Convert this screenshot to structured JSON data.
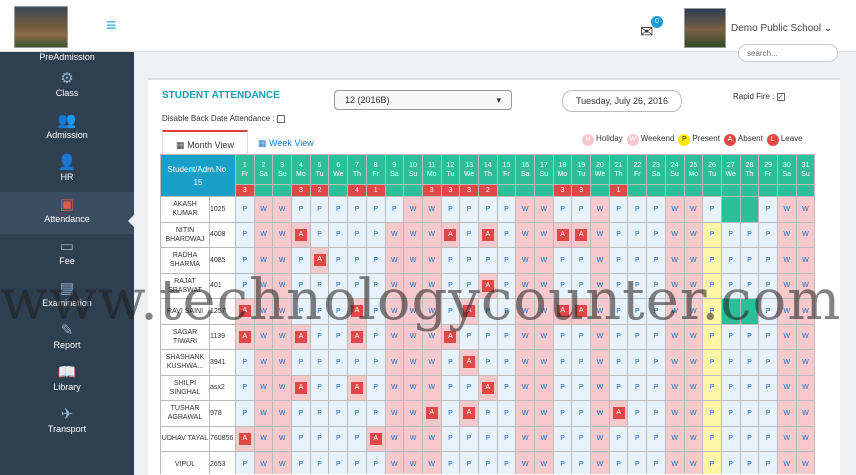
{
  "topbar": {
    "notification_count": "0",
    "school_name": "Demo Public School ⌄"
  },
  "sidebar": {
    "top_label": "PreAdmission",
    "items": [
      {
        "label": "Class",
        "icon": "gear-icon",
        "glyph": "⚙"
      },
      {
        "label": "Admission",
        "icon": "users-icon",
        "glyph": "👥"
      },
      {
        "label": "HR",
        "icon": "person-icon",
        "glyph": "👤"
      },
      {
        "label": "Attendance",
        "icon": "attendance-icon",
        "glyph": "▣"
      },
      {
        "label": "Fee",
        "icon": "card-icon",
        "glyph": "▭"
      },
      {
        "label": "Examination",
        "icon": "exam-icon",
        "glyph": "▤"
      },
      {
        "label": "Report",
        "icon": "edit-icon",
        "glyph": "✎"
      },
      {
        "label": "Library",
        "icon": "book-icon",
        "glyph": "📖"
      },
      {
        "label": "Transport",
        "icon": "plane-icon",
        "glyph": "✈"
      }
    ]
  },
  "search": {
    "placeholder": "search..."
  },
  "attendance": {
    "title": "STUDENT ATTENDANCE",
    "class_selected": "12 (2016B)",
    "date": "Tuesday, July 26, 2016",
    "rapid_fire_label": "Rapid Fire :",
    "disable_back_label": "Disable Back Date Attendance :",
    "tab_month": "Month View",
    "tab_week": "Week View",
    "legend": [
      {
        "key": "H",
        "label": "Holiday"
      },
      {
        "key": "W",
        "label": "Weekend"
      },
      {
        "key": "P",
        "label": "Present"
      },
      {
        "key": "A",
        "label": "Absent"
      },
      {
        "key": "L",
        "label": "Leave"
      }
    ],
    "header_student": "Student/Adm.No.",
    "header_count": "15",
    "days": [
      [
        "1",
        "Fr"
      ],
      [
        "2",
        "Sa"
      ],
      [
        "3",
        "Su"
      ],
      [
        "4",
        "Mo"
      ],
      [
        "5",
        "Tu"
      ],
      [
        "6",
        "We"
      ],
      [
        "7",
        "Th"
      ],
      [
        "8",
        "Fr"
      ],
      [
        "9",
        "Sa"
      ],
      [
        "10",
        "Su"
      ],
      [
        "11",
        "Mo"
      ],
      [
        "12",
        "Tu"
      ],
      [
        "13",
        "We"
      ],
      [
        "14",
        "Th"
      ],
      [
        "15",
        "Fr"
      ],
      [
        "16",
        "Sa"
      ],
      [
        "17",
        "Su"
      ],
      [
        "18",
        "Mo"
      ],
      [
        "19",
        "Tu"
      ],
      [
        "20",
        "We"
      ],
      [
        "21",
        "Th"
      ],
      [
        "22",
        "Fr"
      ],
      [
        "23",
        "Sa"
      ],
      [
        "24",
        "Su"
      ],
      [
        "25",
        "Mo"
      ],
      [
        "26",
        "Tu"
      ],
      [
        "27",
        "We"
      ],
      [
        "28",
        "Th"
      ],
      [
        "29",
        "Fr"
      ],
      [
        "30",
        "Sa"
      ],
      [
        "31",
        "Su"
      ]
    ],
    "absent_counts": [
      "3",
      "",
      "",
      "3",
      "2",
      "",
      "4",
      "1",
      "",
      "",
      "3",
      "3",
      "3",
      "2",
      "",
      "",
      "",
      "3",
      "3",
      "",
      "1",
      "",
      "",
      "",
      "",
      "",
      "",
      "",
      "",
      "",
      ""
    ],
    "students": [
      {
        "name": "AKASH KUMAR",
        "id": "1025",
        "att": "PWWPPPPPPWWPPPPWWPPWPPPWWPGGPWW"
      },
      {
        "name": "NITIN BHARDWAJ",
        "id": "4008",
        "att": "PWWAPPPPWWWAPAPWWAAWPPPWWYPPPWW"
      },
      {
        "name": "RADHA SHARMA",
        "id": "4085",
        "att": "PWWPAPPPWWWPPPPWWPPWPPPWWYPPPWW"
      },
      {
        "name": "RAJAT SRASWAT",
        "id": "401",
        "att": "PWWPPPPPWWWPPAPWWPPWPPPWWYPPPWW"
      },
      {
        "name": "RAVI SAINI",
        "id": "1257",
        "att": "AWWPPPAPWWWPAPPWWAAWPPPWWYGGPWW"
      },
      {
        "name": "SAGAR TIWARI",
        "id": "1139",
        "att": "AWWAPPAPWWWAPPPWWPPWPPPWWYPPPWW"
      },
      {
        "name": "SHASHANK KUSHWA...",
        "id": "3941",
        "att": "PWWPPPPPWWWPAPPWWPPWPPPWWYPPPWW"
      },
      {
        "name": "SHILPI SINGHAL",
        "id": "asx2",
        "att": "PWWAPPAPWWWPPAPWWPPWPPPWWYPPPWW"
      },
      {
        "name": "TUSHAR AGRAWAL",
        "id": "978",
        "att": "PWWPPPPPWWAPAPPWWPPWAPPWWYPPPWW"
      },
      {
        "name": "UDHAV TAYAL",
        "id": "760856",
        "att": "AWWPPPPAWWWPPPPWWPPWPPPWWYPPPWW"
      },
      {
        "name": "VIPUL",
        "id": "2653",
        "att": "PWWPPPPPWWWPPPPWWPPWPPPWWYPPPWW"
      }
    ]
  },
  "watermark": "www.technologycounter.com",
  "colors": {
    "accent": "#2dbf9a",
    "header": "#1aa0c8",
    "absent": "#e04848",
    "sidebar": "#2e3f50"
  }
}
